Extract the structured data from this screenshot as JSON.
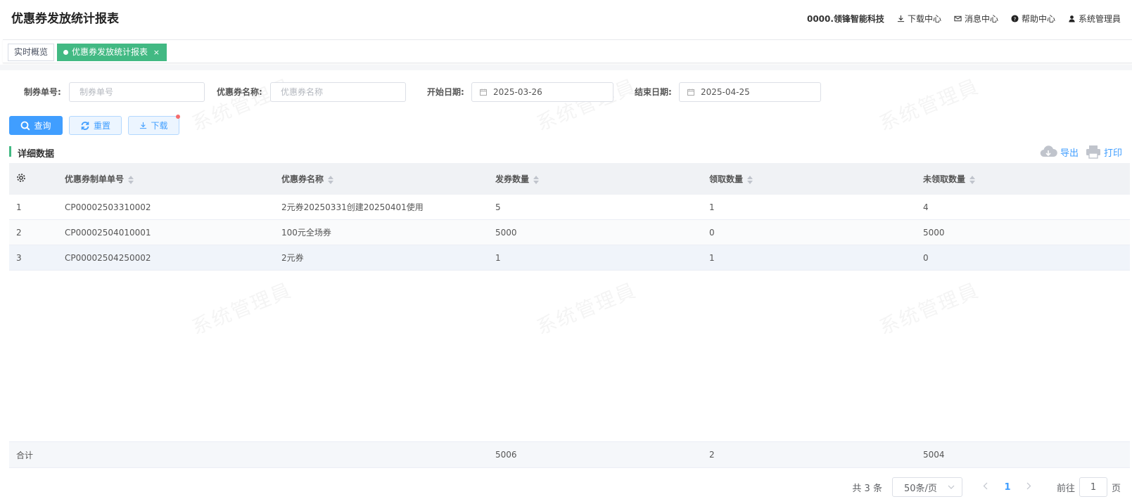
{
  "header": {
    "title": "优惠券发放统计报表",
    "company": "0000.领锋智能科技",
    "download_center": "下载中心",
    "message_center": "消息中心",
    "help_center": "帮助中心",
    "user": "系统管理員"
  },
  "tabs": [
    {
      "label": "实时概览"
    },
    {
      "label": "优惠券发放统计报表",
      "close": "×"
    }
  ],
  "filters": {
    "order_no_label": "制券单号:",
    "order_no_placeholder": "制券单号",
    "coupon_name_label": "优惠券名称:",
    "coupon_name_placeholder": "优惠券名称",
    "start_date_label": "开始日期:",
    "start_date": "2025-03-26",
    "end_date_label": "结束日期:",
    "end_date": "2025-04-25"
  },
  "buttons": {
    "query": "查询",
    "reset": "重置",
    "download": "下载"
  },
  "section": {
    "title": "详细数据",
    "export": "导出",
    "print": "打印"
  },
  "table": {
    "headers": [
      "优惠券制单单号",
      "优惠券名称",
      "发券数量",
      "领取数量",
      "未领取数量"
    ],
    "rows": [
      [
        "1",
        "CP00002503310002",
        "2元券20250331创建20250401使用",
        "5",
        "1",
        "4"
      ],
      [
        "2",
        "CP00002504010001",
        "100元全场券",
        "5000",
        "0",
        "5000"
      ],
      [
        "3",
        "CP00002504250002",
        "2元券",
        "1",
        "1",
        "0"
      ]
    ],
    "footer": {
      "label": "合计",
      "issued": "5006",
      "claimed": "2",
      "unclaimed": "5004"
    }
  },
  "watermark": "系统管理員",
  "pagination": {
    "total": "共 3 条",
    "page_size": "50条/页",
    "current": "1",
    "goto_label": "前往",
    "goto_value": "1",
    "page_unit": "页"
  }
}
